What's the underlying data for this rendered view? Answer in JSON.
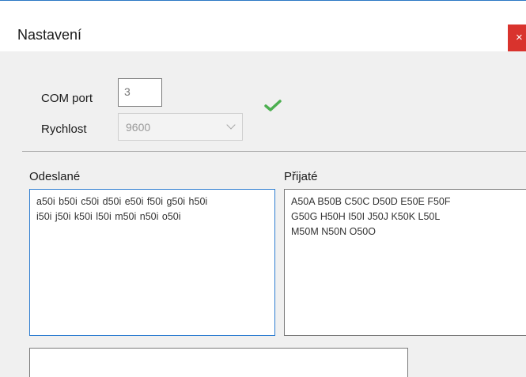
{
  "window": {
    "title": "Nastavení",
    "close_glyph": "×"
  },
  "settings": {
    "com_port_label": "COM port",
    "com_port_value": "3",
    "speed_label": "Rychlost",
    "speed_value": "9600",
    "status_icon": "checkmark-icon",
    "status_color": "#4caf50"
  },
  "sent": {
    "label": "Odeslané",
    "text": "a50i b50i c50i d50i e50i f50i g50i h50i\ni50i j50i k50i l50i m50i n50i o50i"
  },
  "received": {
    "label": "Přijaté",
    "text": "A50A B50B C50C D50D E50E F50F\nG50G H50H I50I J50J K50K L50L\nM50M N50N O50O"
  },
  "input": {
    "value": ""
  },
  "colors": {
    "accent": "#2f7ed1",
    "close_button": "#d9332d"
  }
}
